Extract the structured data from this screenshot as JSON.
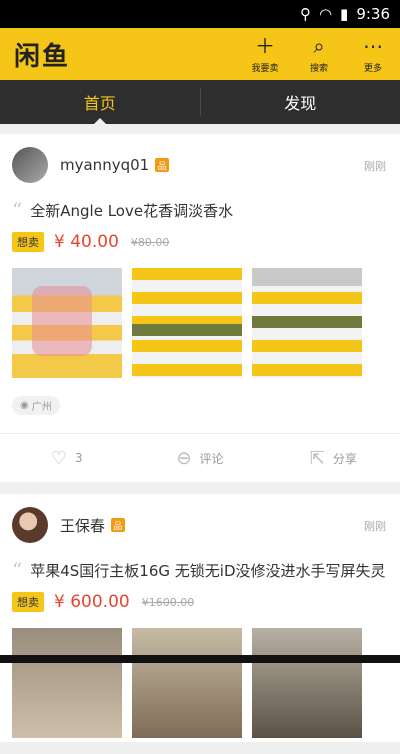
{
  "status_bar": {
    "time": "9:36",
    "icons": [
      "location-icon",
      "wifi-icon",
      "battery-icon"
    ]
  },
  "app_bar": {
    "logo": "闲鱼",
    "actions": [
      {
        "icon": "plus-icon",
        "label": "我要卖"
      },
      {
        "icon": "search-icon",
        "label": "搜索"
      },
      {
        "icon": "more-icon",
        "label": "更多"
      }
    ]
  },
  "tabs": [
    {
      "label": "首页",
      "active": true
    },
    {
      "label": "发现",
      "active": false
    }
  ],
  "feed": [
    {
      "username": "myannyq01",
      "time": "刚刚",
      "description": "全新Angle Love花香调淡香水",
      "tag": "想卖",
      "price": "¥ 40.00",
      "original_price": "¥80.00",
      "location": "广州",
      "likes": "3",
      "comment_label": "评论",
      "share_label": "分享"
    },
    {
      "username": "王保春",
      "time": "刚刚",
      "description": "苹果4S国行主板16G 无锁无iD没修没进水手写屏失灵",
      "tag": "想卖",
      "price": "¥ 600.00",
      "original_price": "¥1600.00"
    }
  ],
  "colors": {
    "accent": "#f5c518",
    "price": "#e8452c",
    "tabbar": "#2e2e2e"
  }
}
